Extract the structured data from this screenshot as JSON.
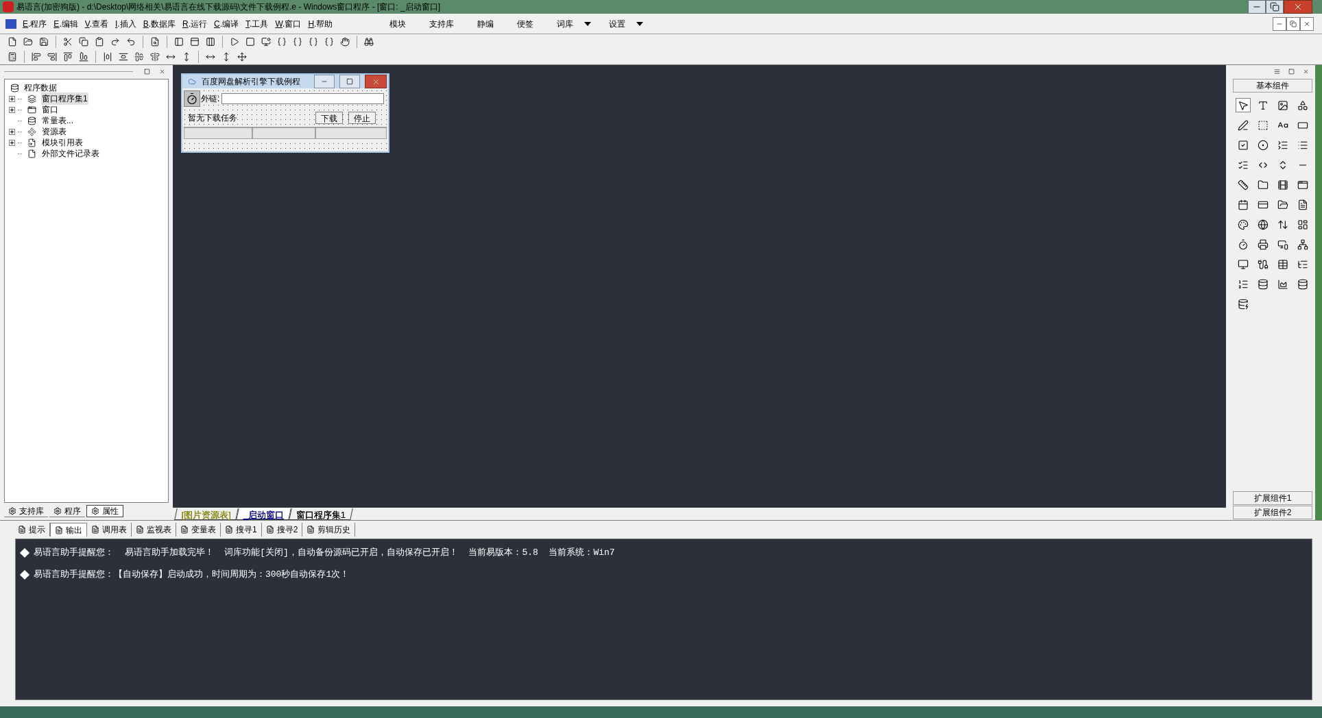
{
  "window": {
    "title": "易语言(加密狗版) - d:\\Desktop\\网络相关\\易语言在线下载源码\\文件下载例程.e - Windows窗口程序 - [窗口: _启动窗口]"
  },
  "menu": [
    {
      "key": "E",
      "label": ".程序"
    },
    {
      "key": "E",
      "label": ".编辑"
    },
    {
      "key": "V",
      "label": ".查看"
    },
    {
      "key": "I",
      "label": ".插入"
    },
    {
      "key": "B",
      "label": ".数据库"
    },
    {
      "key": "R",
      "label": ".运行"
    },
    {
      "key": "C",
      "label": ".编译"
    },
    {
      "key": "T",
      "label": ".工具"
    },
    {
      "key": "W",
      "label": ".窗口"
    },
    {
      "key": "H",
      "label": ".帮助"
    }
  ],
  "extra_menu": [
    {
      "label": "模块",
      "dropdown": false
    },
    {
      "label": "支持库",
      "dropdown": false
    },
    {
      "label": "静编",
      "dropdown": false
    },
    {
      "label": "便签",
      "dropdown": false
    },
    {
      "label": "词库",
      "dropdown": true
    },
    {
      "label": "设置",
      "dropdown": true
    }
  ],
  "tree": {
    "label": "程序数据",
    "children": [
      {
        "label": "窗口程序集1",
        "kind": "group",
        "expanded": false,
        "selected": true
      },
      {
        "label": "窗口",
        "kind": "group",
        "expanded": false,
        "selected": false
      },
      {
        "label": "常量表...",
        "kind": "leaf",
        "selected": false
      },
      {
        "label": "资源表",
        "kind": "group",
        "expanded": false,
        "selected": false
      },
      {
        "label": "模块引用表",
        "kind": "group",
        "expanded": false,
        "selected": false
      },
      {
        "label": "外部文件记录表",
        "kind": "leaf",
        "selected": false
      }
    ]
  },
  "left_tabs": [
    {
      "label": "支持库",
      "selected": false
    },
    {
      "label": "程序",
      "selected": false
    },
    {
      "label": "属性",
      "selected": true
    }
  ],
  "designer": {
    "title": "百度网盘解析引擎下载例程",
    "link_label": "外链:",
    "status": "暂无下载任务",
    "buttons": [
      "下载",
      "停止"
    ]
  },
  "editor_tabs": [
    {
      "label": "[图片资源表]",
      "selected": false,
      "color": "#808000"
    },
    {
      "label": "_启动窗口",
      "selected": true,
      "color": "#000080"
    },
    {
      "label": "窗口程序集1",
      "selected": false,
      "color": "#000000"
    }
  ],
  "components": {
    "header": "基本组件",
    "footer": [
      "扩展组件1",
      "扩展组件2"
    ]
  },
  "bottom_tabs": [
    {
      "label": "提示",
      "selected": false
    },
    {
      "label": "输出",
      "selected": true
    },
    {
      "label": "调用表",
      "selected": false
    },
    {
      "label": "监视表",
      "selected": false
    },
    {
      "label": "变量表",
      "selected": false
    },
    {
      "label": "搜寻1",
      "selected": false
    },
    {
      "label": "搜寻2",
      "selected": false
    },
    {
      "label": "剪辑历史",
      "selected": false
    }
  ],
  "messages": [
    "易语言助手提醒您：  易语言助手加载完毕！  词库功能[关闭]，自动备份源码已开启，自动保存已开启！  当前易版本：5.8  当前系统：Win7",
    "易语言助手提醒您：【自动保存】启动成功，时间周期为：300秒自动保存1次！"
  ]
}
